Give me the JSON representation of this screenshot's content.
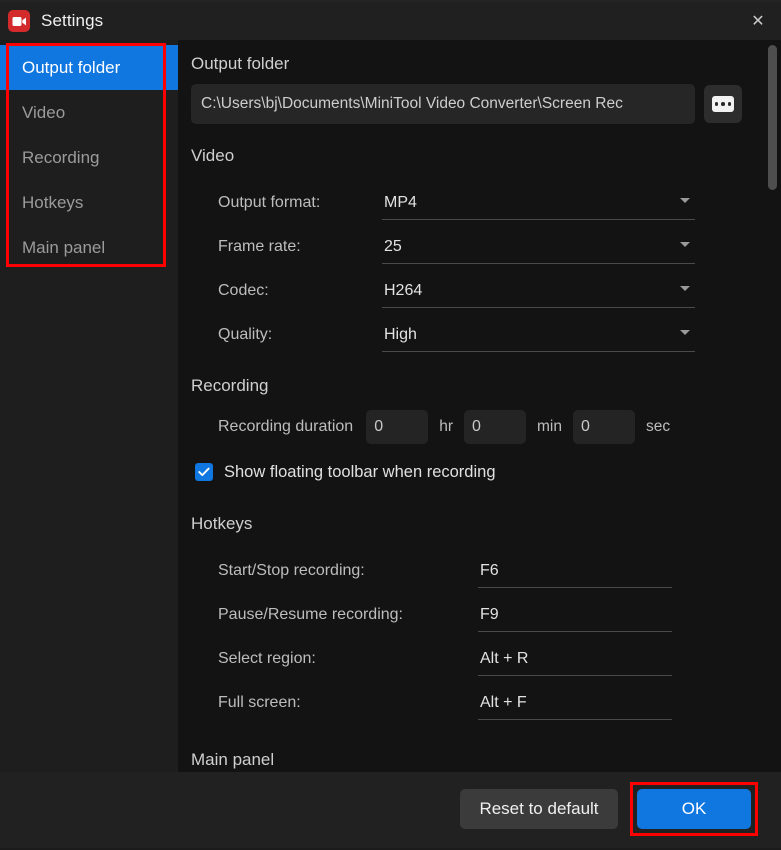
{
  "window": {
    "title": "Settings",
    "app_icon": "video-camera-icon",
    "close_icon": "✕"
  },
  "background": {
    "chevron_icon": "⌄",
    "bottom_text": ""
  },
  "sidebar": {
    "items": [
      {
        "label": "Output folder",
        "selected": true
      },
      {
        "label": "Video",
        "selected": false
      },
      {
        "label": "Recording",
        "selected": false
      },
      {
        "label": "Hotkeys",
        "selected": false
      },
      {
        "label": "Main panel",
        "selected": false
      }
    ]
  },
  "content": {
    "output_folder": {
      "title": "Output folder",
      "path_value": "C:\\Users\\bj\\Documents\\MiniTool Video Converter\\Screen Rec",
      "browse_icon": "ellipsis-icon",
      "browse_label": "..."
    },
    "video": {
      "title": "Video",
      "rows": [
        {
          "label": "Output format:",
          "value": "MP4"
        },
        {
          "label": "Frame rate:",
          "value": "25"
        },
        {
          "label": "Codec:",
          "value": "H264"
        },
        {
          "label": "Quality:",
          "value": "High"
        }
      ]
    },
    "recording": {
      "title": "Recording",
      "duration_label": "Recording duration",
      "hours": "0",
      "hours_unit": "hr",
      "minutes": "0",
      "minutes_unit": "min",
      "seconds": "0",
      "seconds_unit": "sec",
      "floating_toolbar_label": "Show floating toolbar when recording",
      "floating_toolbar_checked": true
    },
    "hotkeys": {
      "title": "Hotkeys",
      "rows": [
        {
          "label": "Start/Stop recording:",
          "value": "F6"
        },
        {
          "label": "Pause/Resume recording:",
          "value": "F9"
        },
        {
          "label": "Select region:",
          "value": "Alt + R"
        },
        {
          "label": "Full screen:",
          "value": "Alt + F"
        }
      ]
    },
    "main_panel": {
      "title": "Main panel"
    }
  },
  "footer": {
    "reset_label": "Reset to default",
    "ok_label": "OK"
  },
  "colors": {
    "accent_blue": "#1076e0",
    "annotation_red": "#fe0000",
    "app_icon_red": "#d32b2b",
    "dialog_bg": "#1e1e1e",
    "content_bg": "#131313"
  }
}
